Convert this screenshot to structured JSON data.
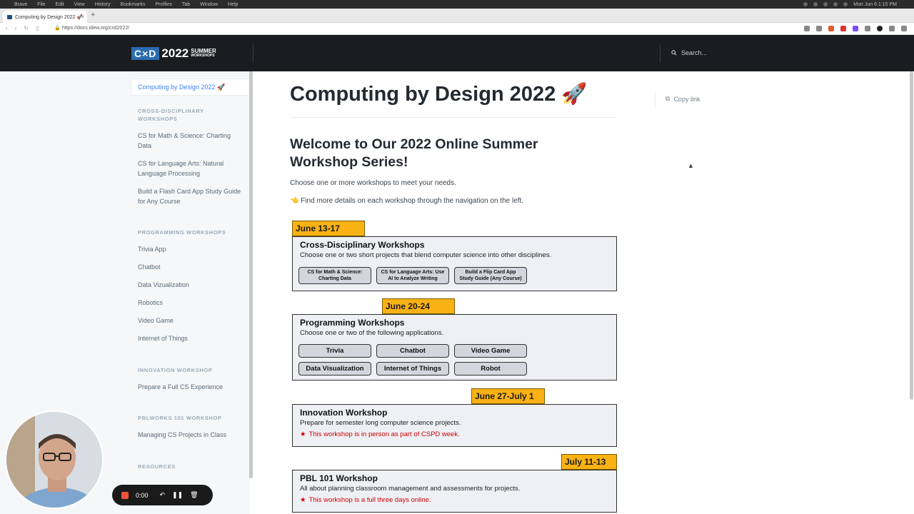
{
  "menubar": {
    "items": [
      "Brave",
      "File",
      "Edit",
      "View",
      "History",
      "Bookmarks",
      "Profiles",
      "Tab",
      "Window",
      "Help"
    ],
    "clock": "Mon Jun 6  1:15 PM"
  },
  "browser": {
    "tab_title": "Computing by Design 2022 🚀",
    "url": "https://docs.idew.org/cxd2022/"
  },
  "header": {
    "logo_cxd": "C×D",
    "logo_year": "2022",
    "logo_summer": "SUMMER",
    "logo_workshops": "WORKSHOPS",
    "search_placeholder": "Search..."
  },
  "sidebar": {
    "active": "Computing by Design 2022 🚀",
    "sections": [
      {
        "heading": "CROSS-DISCIPLINARY WORKSHOPS",
        "items": [
          "CS for Math & Science: Charting Data",
          "CS for Language Arts: Natural Language Processing",
          "Build a Flash Card App Study Guide for Any Course"
        ]
      },
      {
        "heading": "PROGRAMMING WORKSHOPS",
        "items": [
          "Trivia App",
          "Chatbot",
          "Data Vizualization",
          "Robotics",
          "Video Game",
          "Internet of Things"
        ]
      },
      {
        "heading": "INNOVATION WORKSHOP",
        "items": [
          "Prepare a Full CS Experience"
        ]
      },
      {
        "heading": "PBLWORKS 101 WORKSHOP",
        "items": [
          "Managing CS Projects in Class"
        ]
      },
      {
        "heading": "RESOURCES",
        "items": []
      }
    ]
  },
  "main": {
    "title": "Computing by Design 2022 🚀",
    "copy_link": "Copy link",
    "welcome": "Welcome to Our 2022 Online Summer Workshop Series!",
    "intro": "Choose one or more workshops to meet your needs.",
    "details": "👈 Find more details on each workshop through the navigation on the left."
  },
  "workshops": {
    "cross": {
      "date": "June 13-17",
      "title": "Cross-Disciplinary Workshops",
      "desc": "Choose one or two short projects that blend computer science into other disciplines.",
      "options": [
        {
          "l1": "CS for Math & Science:",
          "l2": "Charting Data"
        },
        {
          "l1": "CS for Language Arts: Use",
          "l2": "AI to Analyze Writing"
        },
        {
          "l1": "Build a Flip Card App",
          "l2": "Study Guide (Any Course)"
        }
      ]
    },
    "programming": {
      "date": "June 20-24",
      "title": "Programming Workshops",
      "desc": "Choose one or two of the following applications.",
      "options": [
        "Trivia",
        "Chatbot",
        "Video Game",
        "Data Visualization",
        "Internet of Things",
        "Robot"
      ]
    },
    "innovation": {
      "date": "June 27-July 1",
      "title": "Innovation Workshop",
      "desc": "Prepare for semester long computer science projects.",
      "note": "This workshop is in person as part of CSPD week."
    },
    "pbl": {
      "date": "July 11-13",
      "title": "PBL 101 Workshop",
      "desc": "All about planning classroom management and assessments for projects.",
      "note": "This workshop is a full three days online."
    }
  },
  "recorder": {
    "time": "0:00"
  },
  "colors": {
    "accent": "#3884ff",
    "header_bg": "#1a1c1f",
    "date_orange": "#f9b214",
    "note_red": "#cc0000"
  }
}
